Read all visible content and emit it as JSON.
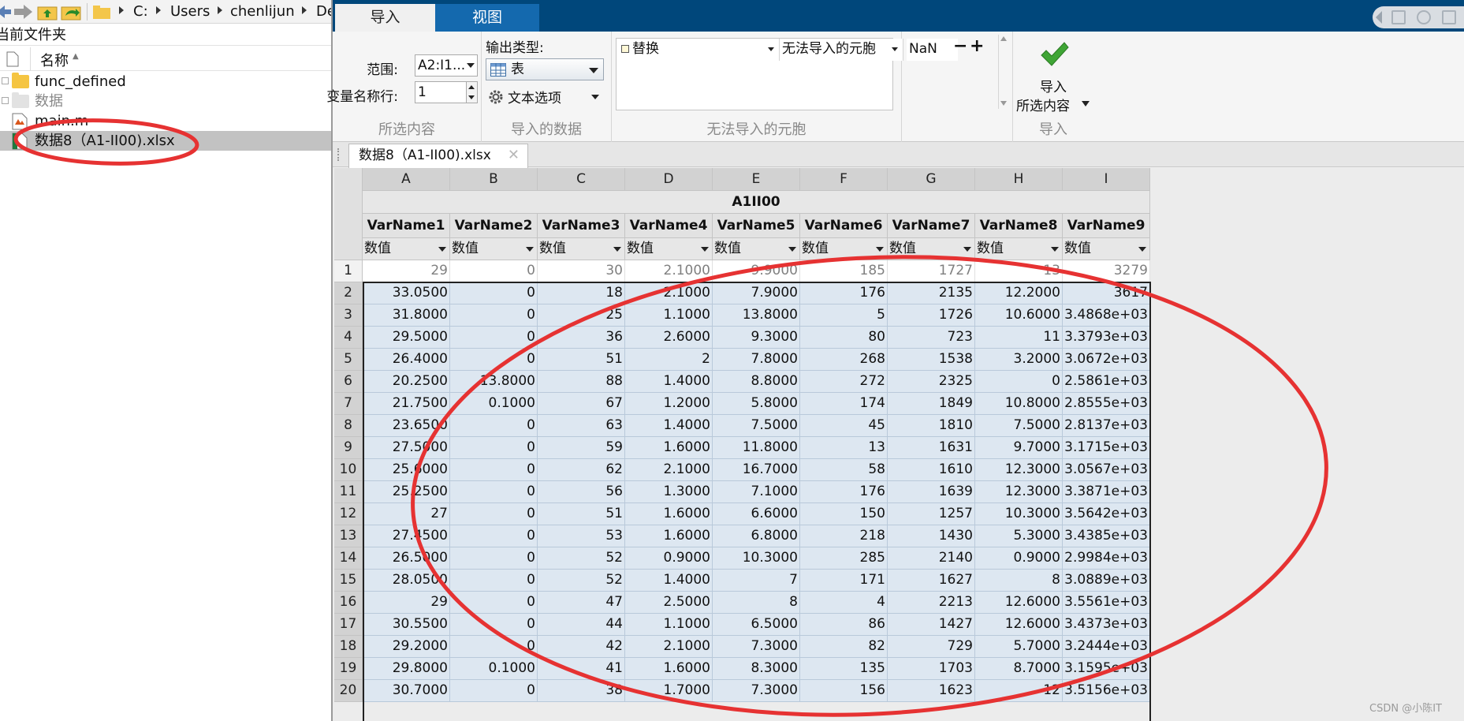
{
  "address_bar": {
    "crumbs": [
      "C:",
      "Users",
      "chenlijun",
      "De"
    ]
  },
  "file_browser": {
    "current_folder_label": "当前文件夹",
    "column_name_header": "名称",
    "files": [
      {
        "name": "func_defined",
        "type": "folder"
      },
      {
        "name": "数据",
        "type": "folder-gray"
      },
      {
        "name": "main.m",
        "type": "m-file"
      },
      {
        "name": "数据8（A1-II00).xlsx",
        "type": "xlsx-file",
        "selected": true
      }
    ]
  },
  "ribbon": {
    "tabs": [
      {
        "label": "导入",
        "active": true
      },
      {
        "label": "视图",
        "active": false
      }
    ],
    "selection": {
      "range_label": "范围:",
      "range_value": "A2:I1...",
      "varname_row_label": "变量名称行:",
      "varname_row_value": "1",
      "section_title": "所选内容"
    },
    "imported_data": {
      "output_type_label": "输出类型:",
      "output_type_value": "表",
      "text_options_label": "文本选项",
      "section_title": "导入的数据"
    },
    "unimportable": {
      "rule_action": "替换",
      "rule_target": "无法导入的元胞",
      "rule_value": "NaN",
      "minus_label": "−",
      "plus_label": "+",
      "section_title": "无法导入的元胞"
    },
    "import": {
      "button_line1": "导入",
      "button_line2": "所选内容",
      "section_title": "导入"
    }
  },
  "document_tab": {
    "label": "数据8（A1-II00).xlsx",
    "close": "✕"
  },
  "sheet": {
    "group_title": "A1II00",
    "columns": [
      "A",
      "B",
      "C",
      "D",
      "E",
      "F",
      "G",
      "H",
      "I"
    ],
    "var_names": [
      "VarName1",
      "VarName2",
      "VarName3",
      "VarName4",
      "VarName5",
      "VarName6",
      "VarName7",
      "VarName8",
      "VarName9"
    ],
    "var_types": [
      "数值",
      "数值",
      "数值",
      "数值",
      "数值",
      "数值",
      "数值",
      "数值",
      "数值"
    ],
    "rows": [
      {
        "n": "1",
        "cells": [
          "29",
          "0",
          "30",
          "2.1000",
          "9.9000",
          "185",
          "1727",
          "13",
          "3279"
        ]
      },
      {
        "n": "2",
        "cells": [
          "33.0500",
          "0",
          "18",
          "2.1000",
          "7.9000",
          "176",
          "2135",
          "12.2000",
          "3617"
        ]
      },
      {
        "n": "3",
        "cells": [
          "31.8000",
          "0",
          "25",
          "1.1000",
          "13.8000",
          "5",
          "1726",
          "10.6000",
          "3.4868e+03"
        ]
      },
      {
        "n": "4",
        "cells": [
          "29.5000",
          "0",
          "36",
          "2.6000",
          "9.3000",
          "80",
          "723",
          "11",
          "3.3793e+03"
        ]
      },
      {
        "n": "5",
        "cells": [
          "26.4000",
          "0",
          "51",
          "2",
          "7.8000",
          "268",
          "1538",
          "3.2000",
          "3.0672e+03"
        ]
      },
      {
        "n": "6",
        "cells": [
          "20.2500",
          "13.8000",
          "88",
          "1.4000",
          "8.8000",
          "272",
          "2325",
          "0",
          "2.5861e+03"
        ]
      },
      {
        "n": "7",
        "cells": [
          "21.7500",
          "0.1000",
          "67",
          "1.2000",
          "5.8000",
          "174",
          "1849",
          "10.8000",
          "2.8555e+03"
        ]
      },
      {
        "n": "8",
        "cells": [
          "23.6500",
          "0",
          "63",
          "1.4000",
          "7.5000",
          "45",
          "1810",
          "7.5000",
          "2.8137e+03"
        ]
      },
      {
        "n": "9",
        "cells": [
          "27.5000",
          "0",
          "59",
          "1.6000",
          "11.8000",
          "13",
          "1631",
          "9.7000",
          "3.1715e+03"
        ]
      },
      {
        "n": "10",
        "cells": [
          "25.6000",
          "0",
          "62",
          "2.1000",
          "16.7000",
          "58",
          "1610",
          "12.3000",
          "3.0567e+03"
        ]
      },
      {
        "n": "11",
        "cells": [
          "25.2500",
          "0",
          "56",
          "1.3000",
          "7.1000",
          "176",
          "1639",
          "12.3000",
          "3.3871e+03"
        ]
      },
      {
        "n": "12",
        "cells": [
          "27",
          "0",
          "51",
          "1.6000",
          "6.6000",
          "150",
          "1257",
          "10.3000",
          "3.5642e+03"
        ]
      },
      {
        "n": "13",
        "cells": [
          "27.4500",
          "0",
          "53",
          "1.6000",
          "6.8000",
          "218",
          "1430",
          "5.3000",
          "3.4385e+03"
        ]
      },
      {
        "n": "14",
        "cells": [
          "26.5000",
          "0",
          "52",
          "0.9000",
          "10.3000",
          "285",
          "2140",
          "0.9000",
          "2.9984e+03"
        ]
      },
      {
        "n": "15",
        "cells": [
          "28.0500",
          "0",
          "52",
          "1.4000",
          "7",
          "171",
          "1627",
          "8",
          "3.0889e+03"
        ]
      },
      {
        "n": "16",
        "cells": [
          "29",
          "0",
          "47",
          "2.5000",
          "8",
          "4",
          "2213",
          "12.6000",
          "3.5561e+03"
        ]
      },
      {
        "n": "17",
        "cells": [
          "30.5500",
          "0",
          "44",
          "1.1000",
          "6.5000",
          "86",
          "1427",
          "12.6000",
          "3.4373e+03"
        ]
      },
      {
        "n": "18",
        "cells": [
          "29.2000",
          "0",
          "42",
          "2.1000",
          "7.3000",
          "82",
          "729",
          "5.7000",
          "3.2444e+03"
        ]
      },
      {
        "n": "19",
        "cells": [
          "29.8000",
          "0.1000",
          "41",
          "1.6000",
          "8.3000",
          "135",
          "1703",
          "8.7000",
          "3.1595e+03"
        ]
      },
      {
        "n": "20",
        "cells": [
          "30.7000",
          "0",
          "38",
          "1.7000",
          "7.3000",
          "156",
          "1623",
          "12",
          "3.5156e+03"
        ]
      }
    ]
  },
  "annotation_color": "#e63232",
  "watermark": "CSDN @小陈IT"
}
